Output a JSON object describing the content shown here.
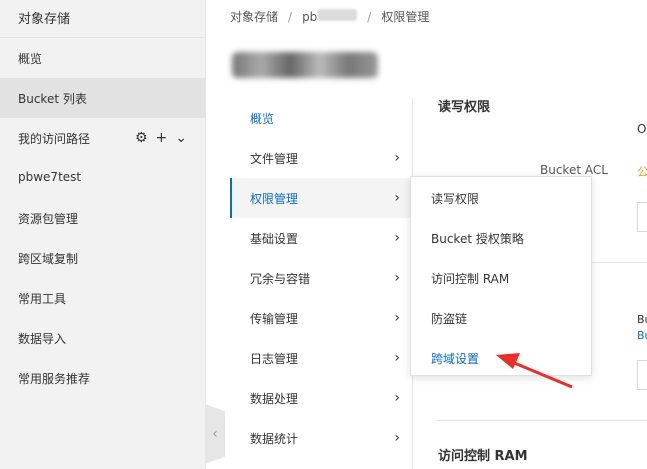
{
  "sidebar": {
    "title": "对象存储",
    "items": [
      {
        "label": "概览"
      },
      {
        "label": "Bucket 列表"
      },
      {
        "label": "我的访问路径"
      },
      {
        "label": "pbwe7test"
      },
      {
        "label": "资源包管理"
      },
      {
        "label": "跨区域复制"
      },
      {
        "label": "常用工具"
      },
      {
        "label": "数据导入"
      },
      {
        "label": "常用服务推荐"
      }
    ],
    "collapse_icon": "‹"
  },
  "breadcrumb": {
    "root": "对象存储",
    "bucket_prefix": "pb",
    "current": "权限管理"
  },
  "subnav": {
    "items": [
      {
        "label": "概览"
      },
      {
        "label": "文件管理"
      },
      {
        "label": "权限管理"
      },
      {
        "label": "基础设置"
      },
      {
        "label": "冗余与容错"
      },
      {
        "label": "传输管理"
      },
      {
        "label": "日志管理"
      },
      {
        "label": "数据处理"
      },
      {
        "label": "数据统计"
      }
    ]
  },
  "content": {
    "section_rw": "读写权限",
    "o_text": "O",
    "acl_label": "Bucket ACL",
    "acl_value": "公",
    "bu_text": "Bu",
    "bu_link": "Bu",
    "section_ram": "访问控制 RAM"
  },
  "dropdown": {
    "items": [
      {
        "label": "读写权限"
      },
      {
        "label": "Bucket 授权策略"
      },
      {
        "label": "访问控制 RAM"
      },
      {
        "label": "防盗链"
      },
      {
        "label": "跨域设置"
      }
    ]
  },
  "colors": {
    "accent": "#0b6bc6",
    "arrow": "#e8302a",
    "warning": "#f0a020"
  }
}
